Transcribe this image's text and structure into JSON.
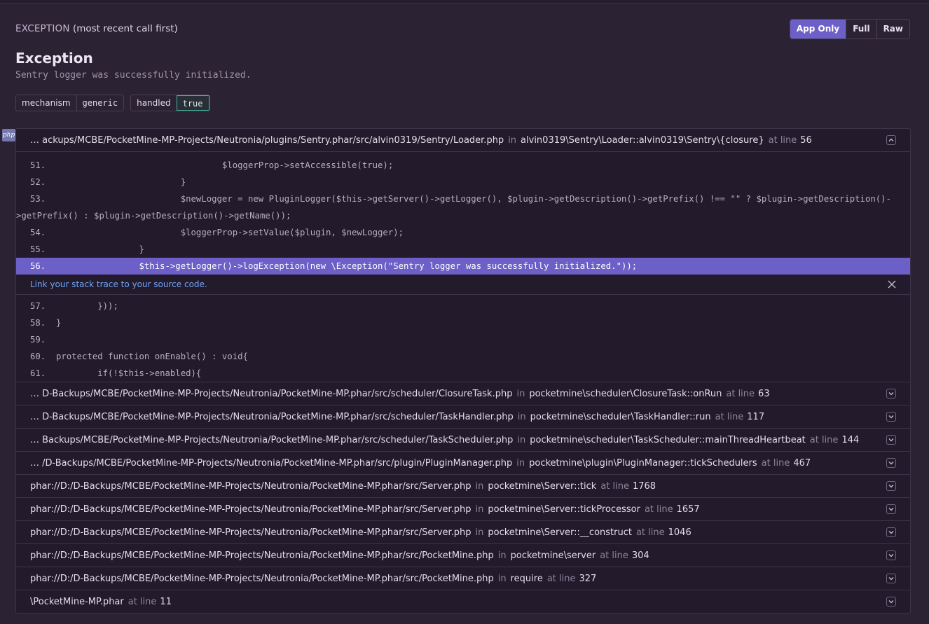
{
  "header": {
    "label_strong": "EXCEPTION",
    "label_rest": "(most recent call first)",
    "view_buttons": [
      "App Only",
      "Full",
      "Raw"
    ],
    "active_view": "App Only"
  },
  "exception": {
    "type": "Exception",
    "value": "Sentry logger was successfully initialized."
  },
  "tags": [
    {
      "key": "mechanism",
      "value": "generic"
    },
    {
      "key": "handled",
      "value": "true"
    }
  ],
  "lang_badge": "php",
  "connectors": {
    "in": "in",
    "at_line": "at line"
  },
  "expanded_frame": {
    "path": "… ackups/MCBE/PocketMine-MP-Projects/Neutronia/plugins/Sentry.phar/src/alvin0319/Sentry/Loader.php",
    "function": "alvin0319\\Sentry\\Loader::alvin0319\\Sentry\\{closure}",
    "line": "56",
    "context_before": [
      {
        "ln": "51.",
        "code": "                                $loggerProp->setAccessible(true);"
      },
      {
        "ln": "52.",
        "code": "                        }"
      },
      {
        "ln": "53.",
        "code": "                        $newLogger = new PluginLogger($this->getServer()->getLogger(), $plugin->getDescription()->getPrefix() !== \"\" ? $plugin->getDescription()-"
      },
      {
        "ln": "",
        "code": ">getPrefix() : $plugin->getDescription()->getName());"
      },
      {
        "ln": "54.",
        "code": "                        $loggerProp->setValue($plugin, $newLogger);"
      },
      {
        "ln": "55.",
        "code": "                }"
      }
    ],
    "highlight": {
      "ln": "56.",
      "code": "                $this->getLogger()->logException(new \\Exception(\"Sentry logger was successfully initialized.\"));"
    },
    "link_text": "Link your stack trace to your source code.",
    "context_after": [
      {
        "ln": "57.",
        "code": "        }));"
      },
      {
        "ln": "58.",
        "code": "}"
      },
      {
        "ln": "59.",
        "code": ""
      },
      {
        "ln": "60.",
        "code": "protected function onEnable() : void{"
      },
      {
        "ln": "61.",
        "code": "        if(!$this->enabled){"
      }
    ]
  },
  "frames": [
    {
      "path": "… D-Backups/MCBE/PocketMine-MP-Projects/Neutronia/PocketMine-MP.phar/src/scheduler/ClosureTask.php",
      "function": "pocketmine\\scheduler\\ClosureTask::onRun",
      "line": "63"
    },
    {
      "path": "… D-Backups/MCBE/PocketMine-MP-Projects/Neutronia/PocketMine-MP.phar/src/scheduler/TaskHandler.php",
      "function": "pocketmine\\scheduler\\TaskHandler::run",
      "line": "117"
    },
    {
      "path": "… Backups/MCBE/PocketMine-MP-Projects/Neutronia/PocketMine-MP.phar/src/scheduler/TaskScheduler.php",
      "function": "pocketmine\\scheduler\\TaskScheduler::mainThreadHeartbeat",
      "line": "144"
    },
    {
      "path": "… /D-Backups/MCBE/PocketMine-MP-Projects/Neutronia/PocketMine-MP.phar/src/plugin/PluginManager.php",
      "function": "pocketmine\\plugin\\PluginManager::tickSchedulers",
      "line": "467"
    },
    {
      "path": "phar://D:/D-Backups/MCBE/PocketMine-MP-Projects/Neutronia/PocketMine-MP.phar/src/Server.php",
      "function": "pocketmine\\Server::tick",
      "line": "1768"
    },
    {
      "path": "phar://D:/D-Backups/MCBE/PocketMine-MP-Projects/Neutronia/PocketMine-MP.phar/src/Server.php",
      "function": "pocketmine\\Server::tickProcessor",
      "line": "1657"
    },
    {
      "path": "phar://D:/D-Backups/MCBE/PocketMine-MP-Projects/Neutronia/PocketMine-MP.phar/src/Server.php",
      "function": "pocketmine\\Server::__construct",
      "line": "1046"
    },
    {
      "path": "phar://D:/D-Backups/MCBE/PocketMine-MP-Projects/Neutronia/PocketMine-MP.phar/src/PocketMine.php",
      "function": "pocketmine\\server",
      "line": "304"
    },
    {
      "path": "phar://D:/D-Backups/MCBE/PocketMine-MP-Projects/Neutronia/PocketMine-MP.phar/src/PocketMine.php",
      "function": "require",
      "line": "327"
    },
    {
      "path": "\\PocketMine-MP.phar",
      "function": "",
      "line": "11"
    }
  ],
  "colors": {
    "accent": "#6c5fc7",
    "success": "#3fb59a",
    "link": "#6ea5f5"
  },
  "icons": {
    "collapse": "chevron-up-icon",
    "expand": "chevron-down-icon",
    "close": "close-icon"
  }
}
